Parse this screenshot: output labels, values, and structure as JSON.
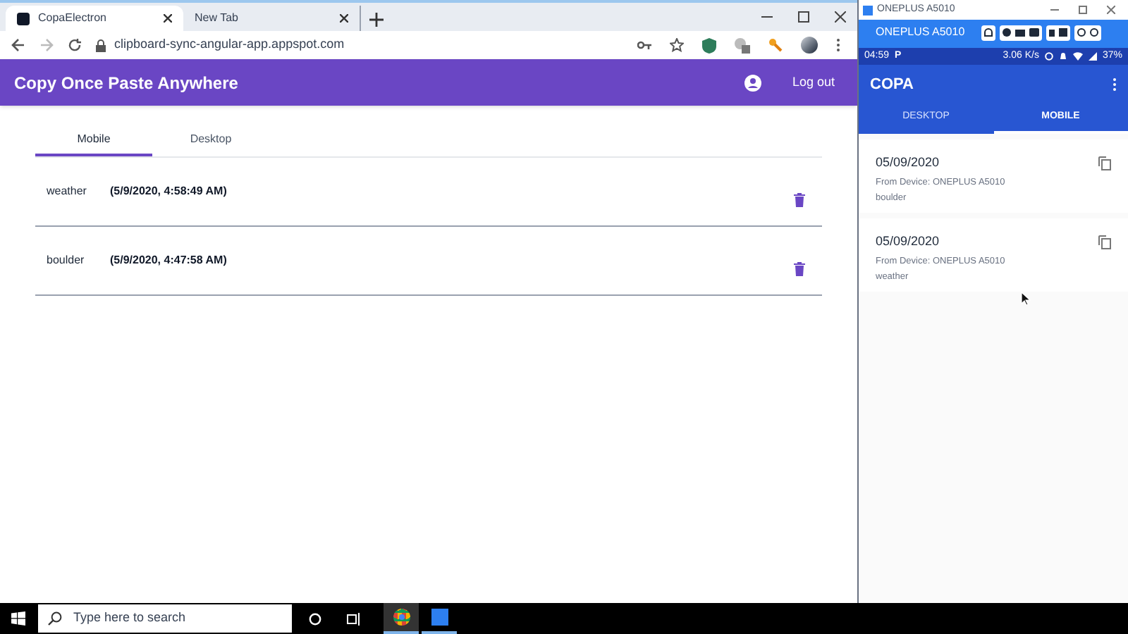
{
  "browser": {
    "tabs": [
      {
        "title": "CopaElectron",
        "selected": true
      },
      {
        "title": "New Tab",
        "selected": false
      }
    ],
    "url": "clipboard-sync-angular-app.appspot.com",
    "app": {
      "title": "Copy Once Paste Anywhere",
      "logout": "Log out",
      "view_tabs": [
        {
          "label": "Mobile",
          "selected": true
        },
        {
          "label": "Desktop",
          "selected": false
        }
      ],
      "clips": [
        {
          "text": "weather",
          "time": "(5/9/2020, 4:58:49 AM)"
        },
        {
          "text": "boulder",
          "time": "(5/9/2020, 4:47:58 AM)"
        }
      ]
    }
  },
  "phone": {
    "window_title": "ONEPLUS A5010",
    "device_name": "ONEPLUS A5010",
    "status": {
      "time": "04:59",
      "app_letter": "P",
      "speed": "3.06 K/s",
      "battery": "37%"
    },
    "app_title": "COPA",
    "tabs": [
      {
        "label": "DESKTOP",
        "selected": false
      },
      {
        "label": "MOBILE",
        "selected": true
      }
    ],
    "clips": [
      {
        "date": "05/09/2020",
        "device": "From Device: ONEPLUS A5010",
        "text": "boulder"
      },
      {
        "date": "05/09/2020",
        "device": "From Device: ONEPLUS A5010",
        "text": "weather"
      }
    ]
  },
  "taskbar": {
    "search_placeholder": "Type here to search"
  }
}
